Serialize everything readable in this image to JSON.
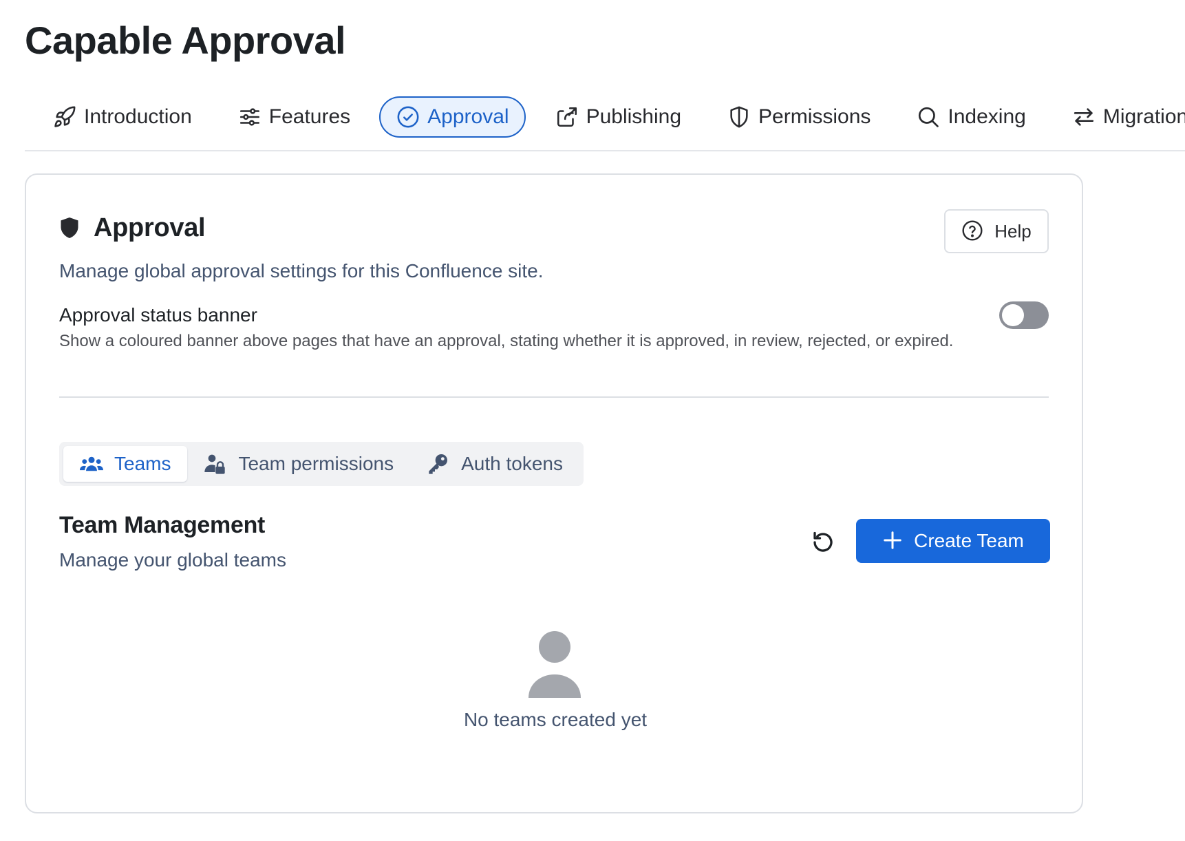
{
  "app": {
    "title": "Capable Approval"
  },
  "nav": {
    "items": [
      {
        "label": "Introduction",
        "icon": "rocket-icon"
      },
      {
        "label": "Features",
        "icon": "sliders-icon"
      },
      {
        "label": "Approval",
        "icon": "check-circle-icon",
        "active": true
      },
      {
        "label": "Publishing",
        "icon": "share-icon"
      },
      {
        "label": "Permissions",
        "icon": "shield-icon"
      },
      {
        "label": "Indexing",
        "icon": "search-icon"
      },
      {
        "label": "Migration",
        "icon": "arrows-swap-icon"
      }
    ]
  },
  "section": {
    "title": "Approval",
    "description": "Manage global approval settings for this Confluence site.",
    "help_label": "Help"
  },
  "setting": {
    "label": "Approval status banner",
    "help": "Show a coloured banner above pages that have an approval, stating whether it is approved, in review, rejected, or expired.",
    "enabled": false
  },
  "subtabs": [
    {
      "label": "Teams",
      "icon": "people-icon",
      "active": true
    },
    {
      "label": "Team permissions",
      "icon": "person-lock-icon"
    },
    {
      "label": "Auth tokens",
      "icon": "key-icon"
    }
  ],
  "team_management": {
    "title": "Team Management",
    "description": "Manage your global teams",
    "create_label": "Create Team",
    "empty_text": "No teams created yet"
  },
  "colors": {
    "accent": "#1868db",
    "active_tab_bg": "#e9f2fe",
    "toggle_off": "#8c8f97"
  }
}
